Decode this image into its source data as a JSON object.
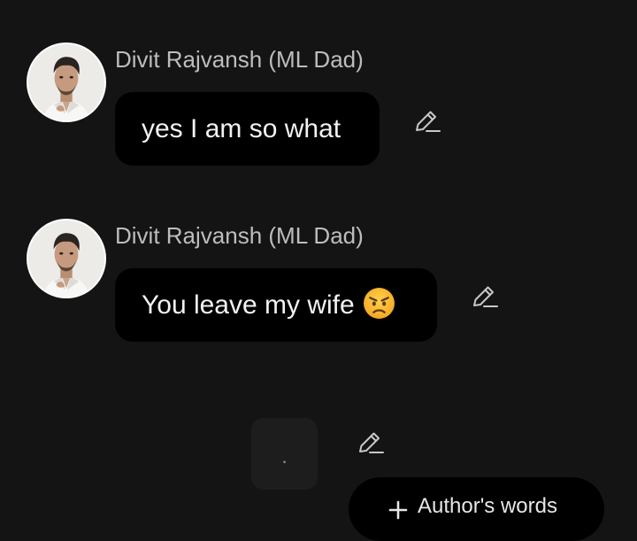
{
  "messages": [
    {
      "sender": "Divit Rajvansh (ML Dad)",
      "text": "yes I am so what",
      "emoji": "",
      "avatar_icon": "man-portrait-avatar",
      "edit_icon": "pencil-edit-icon"
    },
    {
      "sender": "Divit Rajvansh (ML Dad)",
      "text": "You leave my wife",
      "emoji": "angry-face-emoji",
      "avatar_icon": "man-portrait-avatar",
      "edit_icon": "pencil-edit-icon"
    },
    {
      "sender": "",
      "text": ".",
      "emoji": "",
      "edit_icon": "pencil-edit-icon"
    }
  ],
  "authors_button": {
    "label": "Author's words",
    "icon": "plus-icon"
  },
  "colors": {
    "background": "#141414",
    "bubble": "#000000",
    "sender_name": "#bdbdbd",
    "message_text": "#f2f2f2",
    "icon_stroke": "#c8c8c8"
  }
}
